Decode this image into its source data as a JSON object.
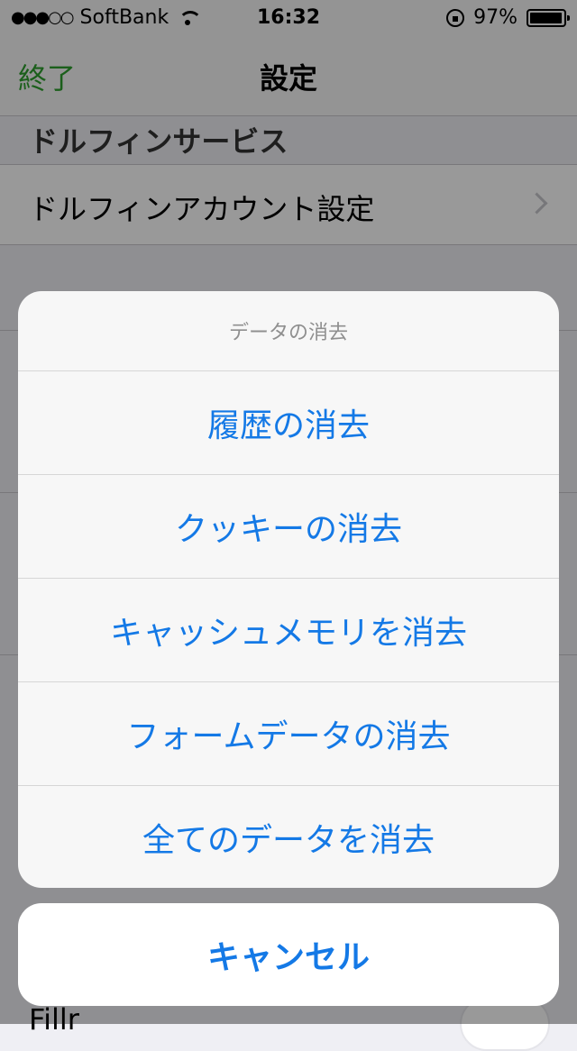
{
  "status_bar": {
    "signal": "●●●○○",
    "carrier": "SoftBank",
    "time": "16:32",
    "battery": "97%",
    "battery_level": 0.97
  },
  "nav": {
    "done_label": "終了",
    "title": "設定"
  },
  "settings": {
    "section_header": "ドルフィンサービス",
    "account_row": "ドルフィンアカウント設定",
    "bottom_row": "Fillr"
  },
  "action_sheet": {
    "title": "データの消去",
    "actions": [
      "履歴の消去",
      "クッキーの消去",
      "キャッシュメモリを消去",
      "フォームデータの消去",
      "全てのデータを消去"
    ],
    "cancel_label": "キャンセル"
  },
  "colors": {
    "accent_blue": "#1479e6",
    "nav_green": "#2e9f2e"
  }
}
